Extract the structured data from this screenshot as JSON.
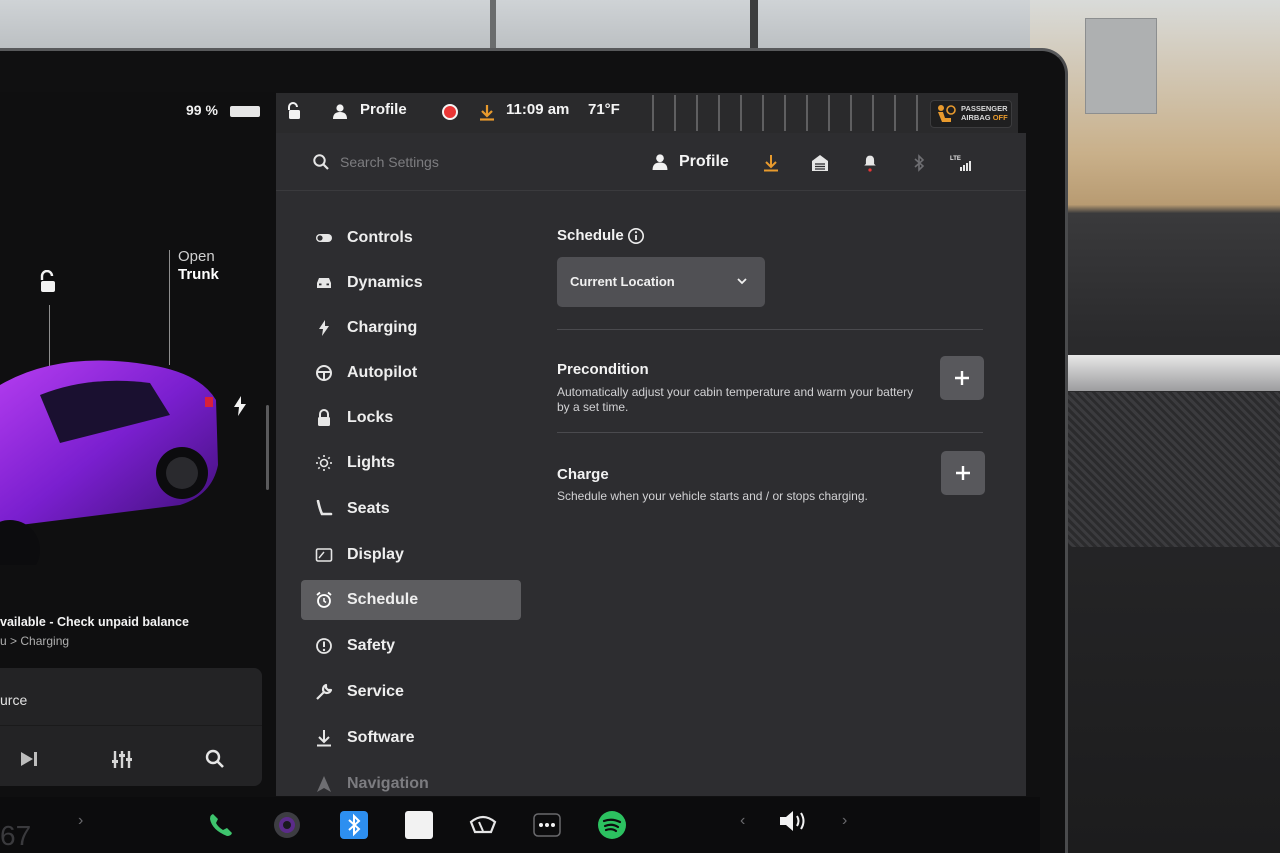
{
  "car": {
    "battery_percent": "99 %",
    "open_label": "Open",
    "trunk_label": "Trunk",
    "message": "vailable - Check unpaid balance",
    "message_sub": "u > Charging",
    "media_title": "urce",
    "speed": "67"
  },
  "status_bar": {
    "profile": "Profile",
    "time": "11:09 am",
    "temperature": "71°F",
    "airbag_line1": "PASSENGER",
    "airbag_line2": "AIRBAG",
    "airbag_line3": "OFF",
    "accent_color": "#e89a2d",
    "record_color": "#e93636"
  },
  "settings": {
    "search_placeholder": "Search Settings",
    "header_profile": "Profile",
    "header_icons": [
      "download-icon",
      "garage-icon",
      "bell-icon",
      "bluetooth-icon",
      "lte-signal-icon"
    ],
    "nav": [
      {
        "label": "Controls",
        "icon": "toggle-icon"
      },
      {
        "label": "Dynamics",
        "icon": "car-icon"
      },
      {
        "label": "Charging",
        "icon": "bolt-icon"
      },
      {
        "label": "Autopilot",
        "icon": "steering-wheel-icon"
      },
      {
        "label": "Locks",
        "icon": "lock-icon"
      },
      {
        "label": "Lights",
        "icon": "sun-icon"
      },
      {
        "label": "Seats",
        "icon": "seat-icon"
      },
      {
        "label": "Display",
        "icon": "display-icon"
      },
      {
        "label": "Schedule",
        "icon": "alarm-clock-icon",
        "active": true
      },
      {
        "label": "Safety",
        "icon": "info-circle-icon"
      },
      {
        "label": "Service",
        "icon": "wrench-icon"
      },
      {
        "label": "Software",
        "icon": "download-icon"
      },
      {
        "label": "Navigation",
        "icon": "navigation-icon"
      }
    ],
    "content": {
      "title": "Schedule",
      "location_dropdown": "Current Location",
      "precondition_title": "Precondition",
      "precondition_desc": "Automatically adjust your cabin temperature and warm your battery by a set time.",
      "charge_title": "Charge",
      "charge_desc": "Schedule when your vehicle starts and / or stops charging."
    }
  },
  "dock": {
    "apps": [
      "phone-icon",
      "camera-icon",
      "bluetooth-icon",
      "notepad-icon",
      "wiper-icon",
      "more-icon",
      "spotify-icon"
    ],
    "volume_icon": "volume-icon"
  }
}
